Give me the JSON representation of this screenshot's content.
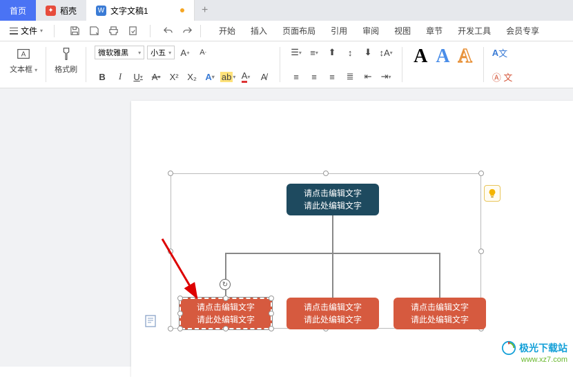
{
  "tabs": {
    "home": "首页",
    "daoke": "稻壳",
    "doc": "文字文稿1"
  },
  "menu": {
    "file": "文件",
    "items": [
      "开始",
      "插入",
      "页面布局",
      "引用",
      "审阅",
      "视图",
      "章节",
      "开发工具",
      "会员专享"
    ]
  },
  "ribbon": {
    "textbox": "文本框",
    "format_painter": "格式刷",
    "font_name": "微软雅黑",
    "font_size": "小五",
    "bold": "B",
    "italic": "I",
    "underline": "U",
    "strike": "A",
    "text_effect": "X",
    "font_grow": "A⁺",
    "font_shrink": "A⁻"
  },
  "org": {
    "top_l1": "请点击编辑文字",
    "top_l2": "请此处编辑文字",
    "child_l1": "请点击编辑文字",
    "child_l2": "请此处编辑文字"
  },
  "watermark": {
    "name": "极光下载站",
    "url": "www.xz7.com"
  }
}
